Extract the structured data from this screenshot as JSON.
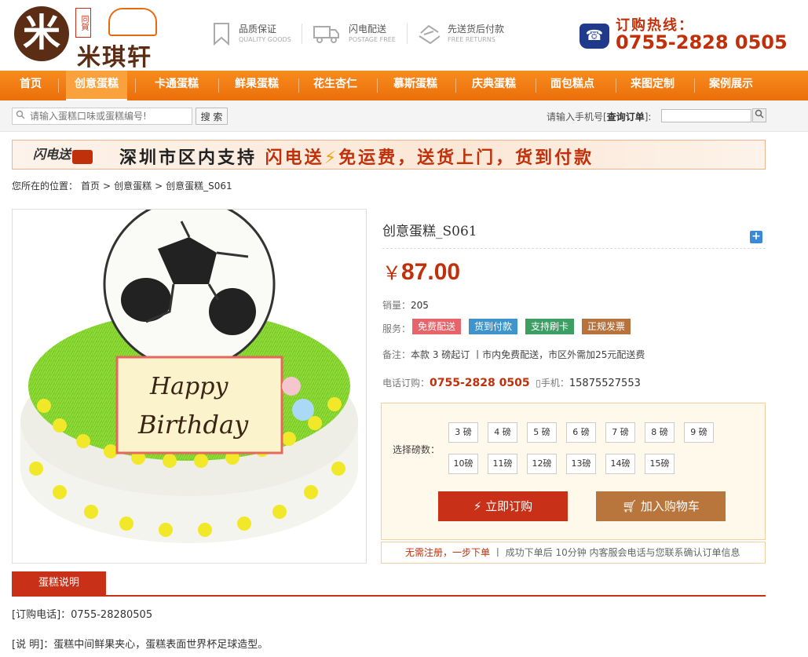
{
  "logo": {
    "seal": "同賀",
    "name": "米琪轩"
  },
  "services": [
    {
      "title": "品质保证",
      "sub": "QUALITY GOODS",
      "icon": "bookmark-icon"
    },
    {
      "title": "闪电配送",
      "sub": "POSTAGE FREE",
      "icon": "truck-icon"
    },
    {
      "title": "先送货后付款",
      "sub": "FREE RETURNS",
      "icon": "return-icon"
    }
  ],
  "hotline": {
    "label": "订购热线：",
    "number": "0755-2828 0505"
  },
  "nav": [
    "首页",
    "创意蛋糕",
    "卡通蛋糕",
    "鲜果蛋糕",
    "花生杏仁",
    "慕斯蛋糕",
    "庆典蛋糕",
    "面包糕点",
    "来图定制",
    "案例展示"
  ],
  "search": {
    "placeholder": "请输入蛋糕口味或蛋糕编号!",
    "button": "搜 索",
    "order_prefix": "请输入手机号[",
    "order_link": "查询订单",
    "order_suffix": "]:"
  },
  "banner": {
    "logo": "闪电送",
    "text_a": "深圳市区内支持 ",
    "text_b": "闪电送",
    "bolt": "⚡",
    "text_c": "免运费，送货上门，货到付款"
  },
  "breadcrumb": [
    "您所在的位置：",
    "首页",
    ">",
    "创意蛋糕",
    ">",
    "创意蛋糕_S061"
  ],
  "cake_text": {
    "line1": "Happy",
    "line2": "Birthday"
  },
  "product": {
    "title": "创意蛋糕_S061",
    "currency": "￥",
    "price": "87.00",
    "sales_label": "销量：",
    "sales": "205",
    "service_label": "服务：",
    "tags": [
      {
        "text": "免费配送",
        "color": "#e8646b"
      },
      {
        "text": "货到付款",
        "color": "#3f94cc"
      },
      {
        "text": "支持刷卡",
        "color": "#3d9e63"
      },
      {
        "text": "正规发票",
        "color": "#b8733c"
      }
    ],
    "note_label": "备注：",
    "note": "本款 3 磅起订 丨市内免费配送，市区外需加25元配送费",
    "phone_label": "电话订购：",
    "phone": "0755-2828 0505",
    "mobile_label": "手机：",
    "mobile": "15875527553"
  },
  "size": {
    "label": "选择磅数：",
    "options": [
      "3 磅",
      "4 磅",
      "5 磅",
      "6 磅",
      "7 磅",
      "8 磅",
      "9 磅",
      "10磅",
      "11磅",
      "12磅",
      "13磅",
      "14磅",
      "15磅"
    ],
    "buy": "立即订购",
    "cart": "加入购物车",
    "foot_red": "无需注册，一步下单",
    "foot_rest": "丨 成功下单后 10分钟 内客服会电话与您联系确认订单信息"
  },
  "tab": "蛋糕说明",
  "desc": {
    "line1": "[订购电话]：0755-28280505",
    "line2": "[说 明]：蛋糕中间鲜果夹心，蛋糕表面世界杯足球造型。"
  }
}
